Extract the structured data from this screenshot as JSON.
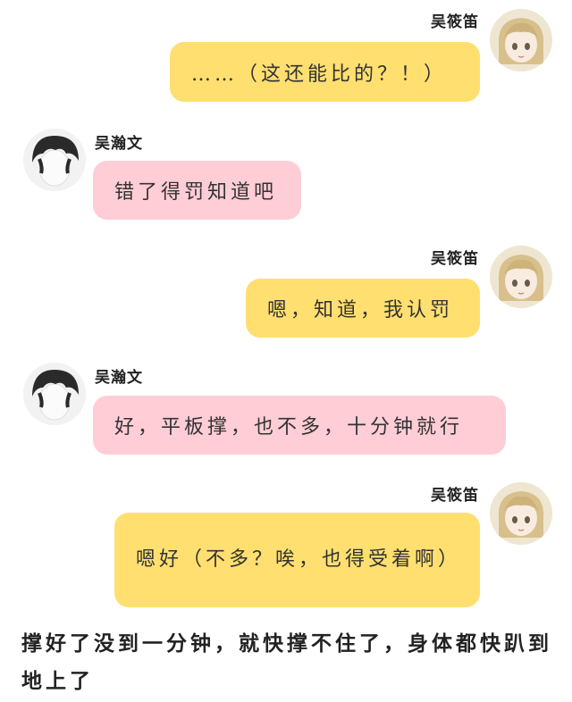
{
  "speakers": {
    "girl": "吴筱笛",
    "boy": "吴瀚文"
  },
  "messages": [
    {
      "speaker": "吴筱笛",
      "side": "right",
      "color": "yellow",
      "text": "……（这还能比的？！）"
    },
    {
      "speaker": "吴瀚文",
      "side": "left",
      "color": "pink",
      "text": "错了得罚知道吧"
    },
    {
      "speaker": "吴筱笛",
      "side": "right",
      "color": "yellow",
      "text": "嗯，知道，我认罚"
    },
    {
      "speaker": "吴瀚文",
      "side": "left",
      "color": "pink",
      "text": "好，平板撑，也不多，十分钟就行"
    },
    {
      "speaker": "吴筱笛",
      "side": "right",
      "color": "yellow",
      "text": "嗯好（不多？唉，也得受着啊）"
    }
  ],
  "narration": "撑好了没到一分钟，就快撑不住了，身体都快趴到地上了",
  "colors": {
    "yellow_bubble": "#ffdf70",
    "pink_bubble": "#ffcdd6"
  },
  "icons": {
    "girl_avatar": "anime-girl-avatar",
    "boy_avatar": "dark-hair-boy-avatar"
  }
}
